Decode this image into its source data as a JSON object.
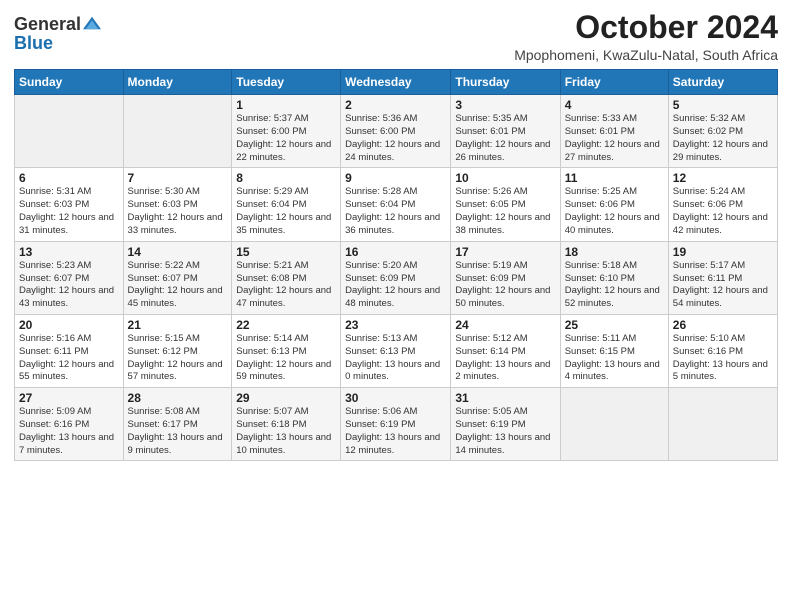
{
  "header": {
    "logo_general": "General",
    "logo_blue": "Blue",
    "month": "October 2024",
    "location": "Mpophomeni, KwaZulu-Natal, South Africa"
  },
  "weekdays": [
    "Sunday",
    "Monday",
    "Tuesday",
    "Wednesday",
    "Thursday",
    "Friday",
    "Saturday"
  ],
  "weeks": [
    [
      {
        "day": "",
        "sunrise": "",
        "sunset": "",
        "daylight": ""
      },
      {
        "day": "",
        "sunrise": "",
        "sunset": "",
        "daylight": ""
      },
      {
        "day": "1",
        "sunrise": "Sunrise: 5:37 AM",
        "sunset": "Sunset: 6:00 PM",
        "daylight": "Daylight: 12 hours and 22 minutes."
      },
      {
        "day": "2",
        "sunrise": "Sunrise: 5:36 AM",
        "sunset": "Sunset: 6:00 PM",
        "daylight": "Daylight: 12 hours and 24 minutes."
      },
      {
        "day": "3",
        "sunrise": "Sunrise: 5:35 AM",
        "sunset": "Sunset: 6:01 PM",
        "daylight": "Daylight: 12 hours and 26 minutes."
      },
      {
        "day": "4",
        "sunrise": "Sunrise: 5:33 AM",
        "sunset": "Sunset: 6:01 PM",
        "daylight": "Daylight: 12 hours and 27 minutes."
      },
      {
        "day": "5",
        "sunrise": "Sunrise: 5:32 AM",
        "sunset": "Sunset: 6:02 PM",
        "daylight": "Daylight: 12 hours and 29 minutes."
      }
    ],
    [
      {
        "day": "6",
        "sunrise": "Sunrise: 5:31 AM",
        "sunset": "Sunset: 6:03 PM",
        "daylight": "Daylight: 12 hours and 31 minutes."
      },
      {
        "day": "7",
        "sunrise": "Sunrise: 5:30 AM",
        "sunset": "Sunset: 6:03 PM",
        "daylight": "Daylight: 12 hours and 33 minutes."
      },
      {
        "day": "8",
        "sunrise": "Sunrise: 5:29 AM",
        "sunset": "Sunset: 6:04 PM",
        "daylight": "Daylight: 12 hours and 35 minutes."
      },
      {
        "day": "9",
        "sunrise": "Sunrise: 5:28 AM",
        "sunset": "Sunset: 6:04 PM",
        "daylight": "Daylight: 12 hours and 36 minutes."
      },
      {
        "day": "10",
        "sunrise": "Sunrise: 5:26 AM",
        "sunset": "Sunset: 6:05 PM",
        "daylight": "Daylight: 12 hours and 38 minutes."
      },
      {
        "day": "11",
        "sunrise": "Sunrise: 5:25 AM",
        "sunset": "Sunset: 6:06 PM",
        "daylight": "Daylight: 12 hours and 40 minutes."
      },
      {
        "day": "12",
        "sunrise": "Sunrise: 5:24 AM",
        "sunset": "Sunset: 6:06 PM",
        "daylight": "Daylight: 12 hours and 42 minutes."
      }
    ],
    [
      {
        "day": "13",
        "sunrise": "Sunrise: 5:23 AM",
        "sunset": "Sunset: 6:07 PM",
        "daylight": "Daylight: 12 hours and 43 minutes."
      },
      {
        "day": "14",
        "sunrise": "Sunrise: 5:22 AM",
        "sunset": "Sunset: 6:07 PM",
        "daylight": "Daylight: 12 hours and 45 minutes."
      },
      {
        "day": "15",
        "sunrise": "Sunrise: 5:21 AM",
        "sunset": "Sunset: 6:08 PM",
        "daylight": "Daylight: 12 hours and 47 minutes."
      },
      {
        "day": "16",
        "sunrise": "Sunrise: 5:20 AM",
        "sunset": "Sunset: 6:09 PM",
        "daylight": "Daylight: 12 hours and 48 minutes."
      },
      {
        "day": "17",
        "sunrise": "Sunrise: 5:19 AM",
        "sunset": "Sunset: 6:09 PM",
        "daylight": "Daylight: 12 hours and 50 minutes."
      },
      {
        "day": "18",
        "sunrise": "Sunrise: 5:18 AM",
        "sunset": "Sunset: 6:10 PM",
        "daylight": "Daylight: 12 hours and 52 minutes."
      },
      {
        "day": "19",
        "sunrise": "Sunrise: 5:17 AM",
        "sunset": "Sunset: 6:11 PM",
        "daylight": "Daylight: 12 hours and 54 minutes."
      }
    ],
    [
      {
        "day": "20",
        "sunrise": "Sunrise: 5:16 AM",
        "sunset": "Sunset: 6:11 PM",
        "daylight": "Daylight: 12 hours and 55 minutes."
      },
      {
        "day": "21",
        "sunrise": "Sunrise: 5:15 AM",
        "sunset": "Sunset: 6:12 PM",
        "daylight": "Daylight: 12 hours and 57 minutes."
      },
      {
        "day": "22",
        "sunrise": "Sunrise: 5:14 AM",
        "sunset": "Sunset: 6:13 PM",
        "daylight": "Daylight: 12 hours and 59 minutes."
      },
      {
        "day": "23",
        "sunrise": "Sunrise: 5:13 AM",
        "sunset": "Sunset: 6:13 PM",
        "daylight": "Daylight: 13 hours and 0 minutes."
      },
      {
        "day": "24",
        "sunrise": "Sunrise: 5:12 AM",
        "sunset": "Sunset: 6:14 PM",
        "daylight": "Daylight: 13 hours and 2 minutes."
      },
      {
        "day": "25",
        "sunrise": "Sunrise: 5:11 AM",
        "sunset": "Sunset: 6:15 PM",
        "daylight": "Daylight: 13 hours and 4 minutes."
      },
      {
        "day": "26",
        "sunrise": "Sunrise: 5:10 AM",
        "sunset": "Sunset: 6:16 PM",
        "daylight": "Daylight: 13 hours and 5 minutes."
      }
    ],
    [
      {
        "day": "27",
        "sunrise": "Sunrise: 5:09 AM",
        "sunset": "Sunset: 6:16 PM",
        "daylight": "Daylight: 13 hours and 7 minutes."
      },
      {
        "day": "28",
        "sunrise": "Sunrise: 5:08 AM",
        "sunset": "Sunset: 6:17 PM",
        "daylight": "Daylight: 13 hours and 9 minutes."
      },
      {
        "day": "29",
        "sunrise": "Sunrise: 5:07 AM",
        "sunset": "Sunset: 6:18 PM",
        "daylight": "Daylight: 13 hours and 10 minutes."
      },
      {
        "day": "30",
        "sunrise": "Sunrise: 5:06 AM",
        "sunset": "Sunset: 6:19 PM",
        "daylight": "Daylight: 13 hours and 12 minutes."
      },
      {
        "day": "31",
        "sunrise": "Sunrise: 5:05 AM",
        "sunset": "Sunset: 6:19 PM",
        "daylight": "Daylight: 13 hours and 14 minutes."
      },
      {
        "day": "",
        "sunrise": "",
        "sunset": "",
        "daylight": ""
      },
      {
        "day": "",
        "sunrise": "",
        "sunset": "",
        "daylight": ""
      }
    ]
  ]
}
